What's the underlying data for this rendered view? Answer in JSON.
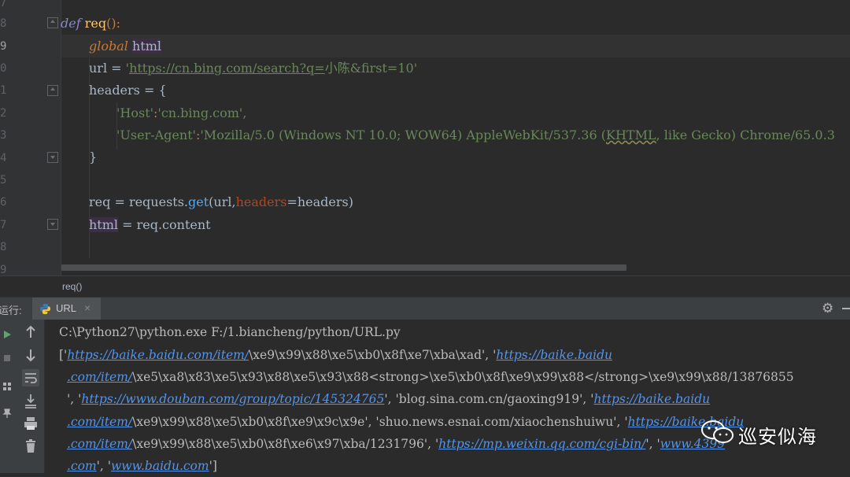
{
  "editor": {
    "line_numbers": [
      "7",
      "8",
      "9",
      "0",
      "1",
      "2",
      "3",
      "4",
      "5",
      "6",
      "7",
      "8",
      "9"
    ],
    "code": {
      "l8_def": "def",
      "l8_name": "req",
      "l8_rest": "():",
      "l9_kw": "global",
      "l9_var": "html",
      "l10_pre": "url = ",
      "l10_q1": "'",
      "l10_url": "https://cn.bing.com/search?q=",
      "l10_rest": "小陈&first=10'",
      "l11": "headers = {",
      "l12_key": "'Host'",
      "l12_colon": ":",
      "l12_val": "'cn.bing.com',",
      "l13_key": "'User-Agent'",
      "l13_colon": ":",
      "l13_val_a": "'Mozilla/5.0 (Windows NT 10.0; WOW64) AppleWebKit/537.36 (",
      "l13_val_khtml": "KHTML",
      "l13_val_b": ", like Gecko) Chrome/65.0.3",
      "l14": "}",
      "l16_a": "req = requests.",
      "l16_get": "get",
      "l16_b": "(url,",
      "l16_param": "headers",
      "l16_c": "=headers)",
      "l17_var": "html",
      "l17_rest": " = req.content"
    }
  },
  "breadcrumb": {
    "text": "req()"
  },
  "run_panel": {
    "label": "运行:",
    "tab_label": "URL",
    "tab_close": "×",
    "gear_glyph": "⚙"
  },
  "console": {
    "command": "C:\\Python27\\python.exe F:/1.biancheng/python/URL.py",
    "l2_a": "['",
    "l2_link1": "https://baike.baidu.com/item/",
    "l2_b": "\\xe9\\x99\\x88\\xe5\\xb0\\x8f\\xe7\\xba\\xad', '",
    "l2_link2": "https://baike.baidu",
    "l3_link": ".com/item/",
    "l3_b": "\\xe5\\xa8\\x83\\xe5\\x93\\x88\\xe5\\x93\\x88<strong>\\xe5\\xb0\\x8f\\xe9\\x99\\x88</strong>\\xe9\\x99\\x88/13876855",
    "l4_a": "', '",
    "l4_link1": "https://www.douban.com/group/topic/145324765",
    "l4_b": "', 'blog.sina.com.cn/gaoxing919', '",
    "l4_link2": "https://baike.baidu",
    "l5_link": ".com/item/",
    "l5_b": "\\xe9\\x99\\x88\\xe5\\xb0\\x8f\\xe9\\x9c\\x9e', 'shuo.news.esnai.com/xiaochenshuiwu', '",
    "l5_link2": "https://baike.baidu",
    "l6_link": ".com/item/",
    "l6_b": "\\xe9\\x99\\x88\\xe5\\xb0\\x8f\\xe6\\x97\\xba/1231796', '",
    "l6_link2": "https://mp.weixin.qq.com/cgi-bin/",
    "l6_c": "', '",
    "l6_link3": "www.4399",
    "l7_link1": ".com",
    "l7_b": "', '",
    "l7_link2": "www.baidu.com",
    "l7_c": "']"
  },
  "watermark": {
    "text": "巡安似海"
  },
  "colors": {
    "keyword": "#cc7832",
    "string": "#6a8759",
    "link": "#5394ec",
    "text": "#a9b7c6"
  }
}
